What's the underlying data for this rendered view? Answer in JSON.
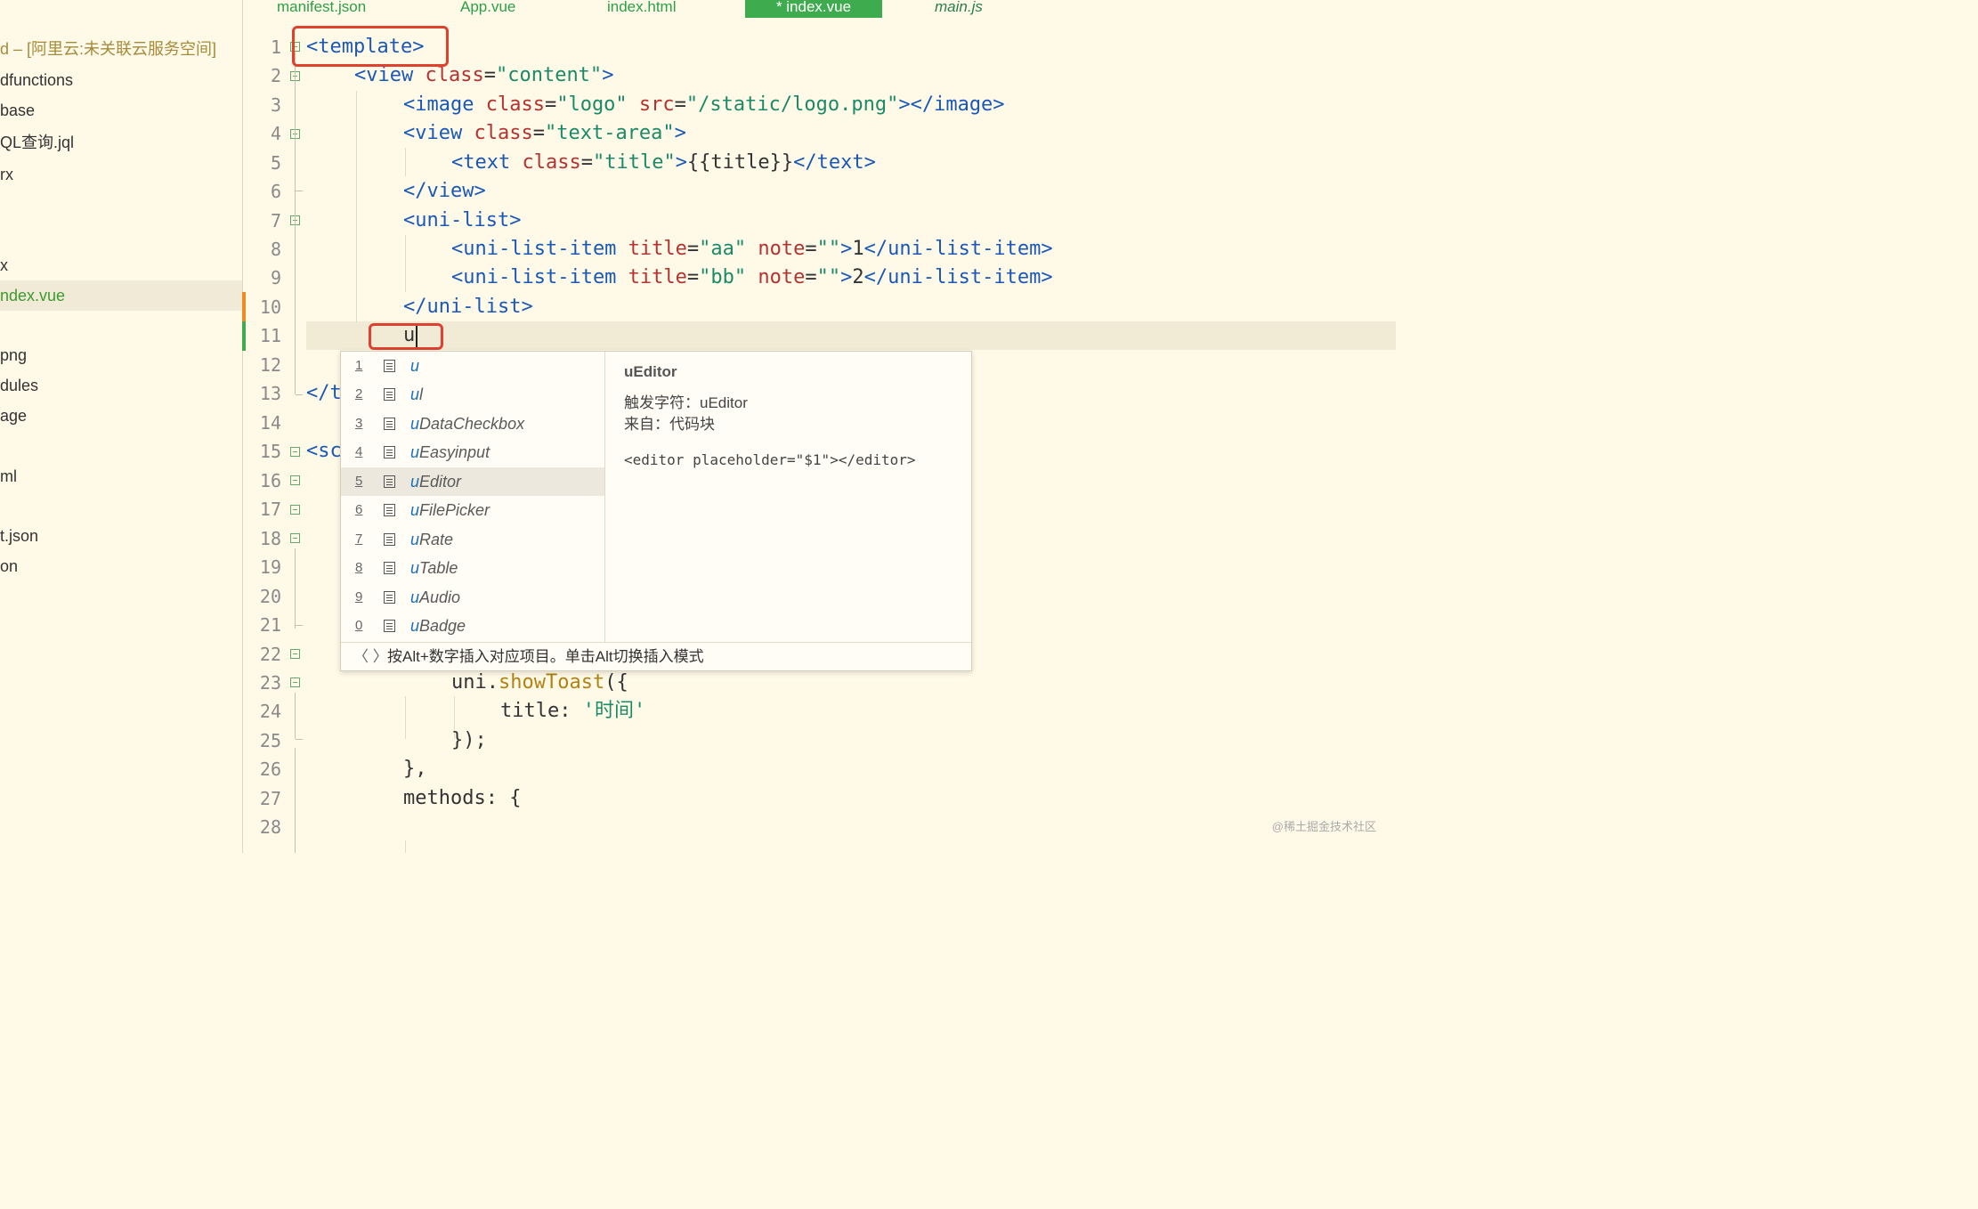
{
  "sidebar": {
    "project_title": "d – [阿里云:未关联云服务空间]",
    "items": [
      "dfunctions",
      "base",
      "QL查询.jql",
      "rx",
      "x",
      "ndex.vue",
      "png",
      "dules",
      "age",
      "ml",
      "t.json",
      "on"
    ]
  },
  "tabs": [
    "manifest.json",
    "App.vue",
    "index.html",
    "* index.vue",
    "main.js"
  ],
  "editor": {
    "line_numbers": [
      "1",
      "2",
      "3",
      "4",
      "5",
      "6",
      "7",
      "8",
      "9",
      "10",
      "11",
      "12",
      "13",
      "14",
      "15",
      "16",
      "17",
      "18",
      "19",
      "20",
      "21",
      "22",
      "23",
      "24",
      "25",
      "26",
      "27",
      "28"
    ],
    "lines": {
      "l1": "<template>",
      "l2a": "<view ",
      "l2b": "class",
      "l2c": "=",
      "l2d": "\"content\"",
      "l2e": ">",
      "l3a": "<image ",
      "l3b": "class",
      "l3c": "=",
      "l3d": "\"logo\"",
      "l3e": " src",
      "l3f": "=",
      "l3g": "\"/static/logo.png\"",
      "l3h": "></image>",
      "l4a": "<view ",
      "l4b": "class",
      "l4c": "=",
      "l4d": "\"text-area\"",
      "l4e": ">",
      "l5a": "<text ",
      "l5b": "class",
      "l5c": "=",
      "l5d": "\"title\"",
      "l5e": ">",
      "l5f": "{{title}}",
      "l5g": "</text>",
      "l6": "</view>",
      "l7": "<uni-list>",
      "l8a": "<uni-list-item ",
      "l8b": "title",
      "l8c": "=",
      "l8d": "\"aa\"",
      "l8e": " note",
      "l8f": "=",
      "l8g": "\"\"",
      "l8h": ">",
      "l8i": "1",
      "l8j": "</uni-list-item>",
      "l9a": "<uni-list-item ",
      "l9b": "title",
      "l9c": "=",
      "l9d": "\"bb\"",
      "l9e": " note",
      "l9f": "=",
      "l9g": "\"\"",
      "l9h": ">",
      "l9i": "2",
      "l9j": "</uni-list-item>",
      "l10": "</uni-list>",
      "l11": "u",
      "l13": "</t",
      "l15": "<sc",
      "l23a": "uni.",
      "l23b": "showToast",
      "l23c": "({",
      "l24a": "title: ",
      "l24b": "'时间'",
      "l25": "});",
      "l26": "},",
      "l27": "methods: {"
    }
  },
  "autocomplete": {
    "items": [
      {
        "num": "1",
        "hl": "u",
        "rest": ""
      },
      {
        "num": "2",
        "hl": "u",
        "rest": "l"
      },
      {
        "num": "3",
        "hl": "u",
        "rest": "DataCheckbox"
      },
      {
        "num": "4",
        "hl": "u",
        "rest": "Easyinput"
      },
      {
        "num": "5",
        "hl": "u",
        "rest": "Editor"
      },
      {
        "num": "6",
        "hl": "u",
        "rest": "FilePicker"
      },
      {
        "num": "7",
        "hl": "u",
        "rest": "Rate"
      },
      {
        "num": "8",
        "hl": "u",
        "rest": "Table"
      },
      {
        "num": "9",
        "hl": "u",
        "rest": "Audio"
      },
      {
        "num": "0",
        "hl": "u",
        "rest": "Badge"
      }
    ],
    "selected_index": 4,
    "detail": {
      "title": "uEditor",
      "trigger": "触发字符：uEditor",
      "source": "来自：代码块",
      "snippet": "<editor placeholder=\"$1\"></editor>"
    },
    "footer": {
      "nav": "〈 〉",
      "message": "按Alt+数字插入对应项目。单击Alt切换插入模式"
    }
  },
  "watermark": "@稀土掘金技术社区"
}
